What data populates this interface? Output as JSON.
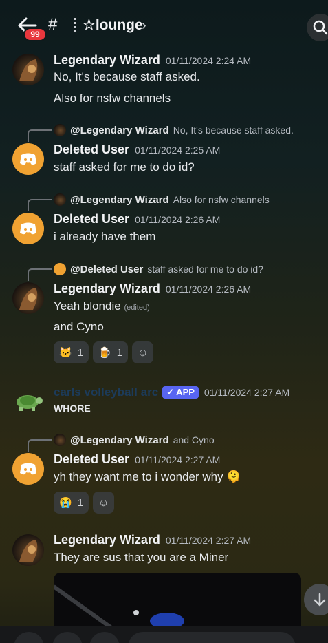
{
  "header": {
    "badge_count": "99",
    "hash": "#",
    "channel_name": "☆lounge",
    "chevron": "›",
    "icons": {
      "back": "back-arrow-icon",
      "search": "search-icon"
    }
  },
  "messages": [
    {
      "author": "Legendary Wizard",
      "time": "01/11/2024 2:24 AM",
      "lines": [
        "No, It's because staff asked.",
        "Also for nsfw channels"
      ]
    },
    {
      "reply_to": "@Legendary Wizard",
      "reply_text": "No, It's because staff asked.",
      "author": "Deleted User",
      "time": "01/11/2024 2:25 AM",
      "lines": [
        "staff asked for me to do id?"
      ]
    },
    {
      "reply_to": "@Legendary Wizard",
      "reply_text": "Also for nsfw channels",
      "author": "Deleted User",
      "time": "01/11/2024 2:26 AM",
      "lines": [
        "i already have them"
      ]
    },
    {
      "reply_to": "@Deleted User",
      "reply_text": "staff asked for me to do id?",
      "author": "Legendary Wizard",
      "time": "01/11/2024 2:26 AM",
      "lines": [
        "Yeah blondie",
        "and Cyno"
      ],
      "edited": "(edited)",
      "reactions": [
        {
          "emoji": "🐱",
          "count": "1"
        },
        {
          "emoji": "🍺",
          "count": "1"
        },
        {
          "emoji": "☺",
          "count": ""
        }
      ]
    },
    {
      "author": "carls volleyball arc",
      "tag": "✓ APP",
      "time": "01/11/2024 2:27 AM",
      "lines": [
        "WHORE"
      ]
    },
    {
      "reply_to": "@Legendary Wizard",
      "reply_text": "and Cyno",
      "author": "Deleted User",
      "time": "01/11/2024 2:27 AM",
      "lines": [
        "yh they want me to i wonder why 🫠"
      ],
      "reactions": [
        {
          "emoji": "😭",
          "count": "1"
        },
        {
          "emoji": "☺",
          "count": ""
        }
      ]
    },
    {
      "author": "Legendary Wizard",
      "time": "01/11/2024 2:27 AM",
      "lines": [
        "They are sus that you are a Miner"
      ]
    }
  ],
  "colors": {
    "accent": "#5865f2",
    "deleted_avatar": "#f0a232",
    "badge": "#e8373d"
  }
}
